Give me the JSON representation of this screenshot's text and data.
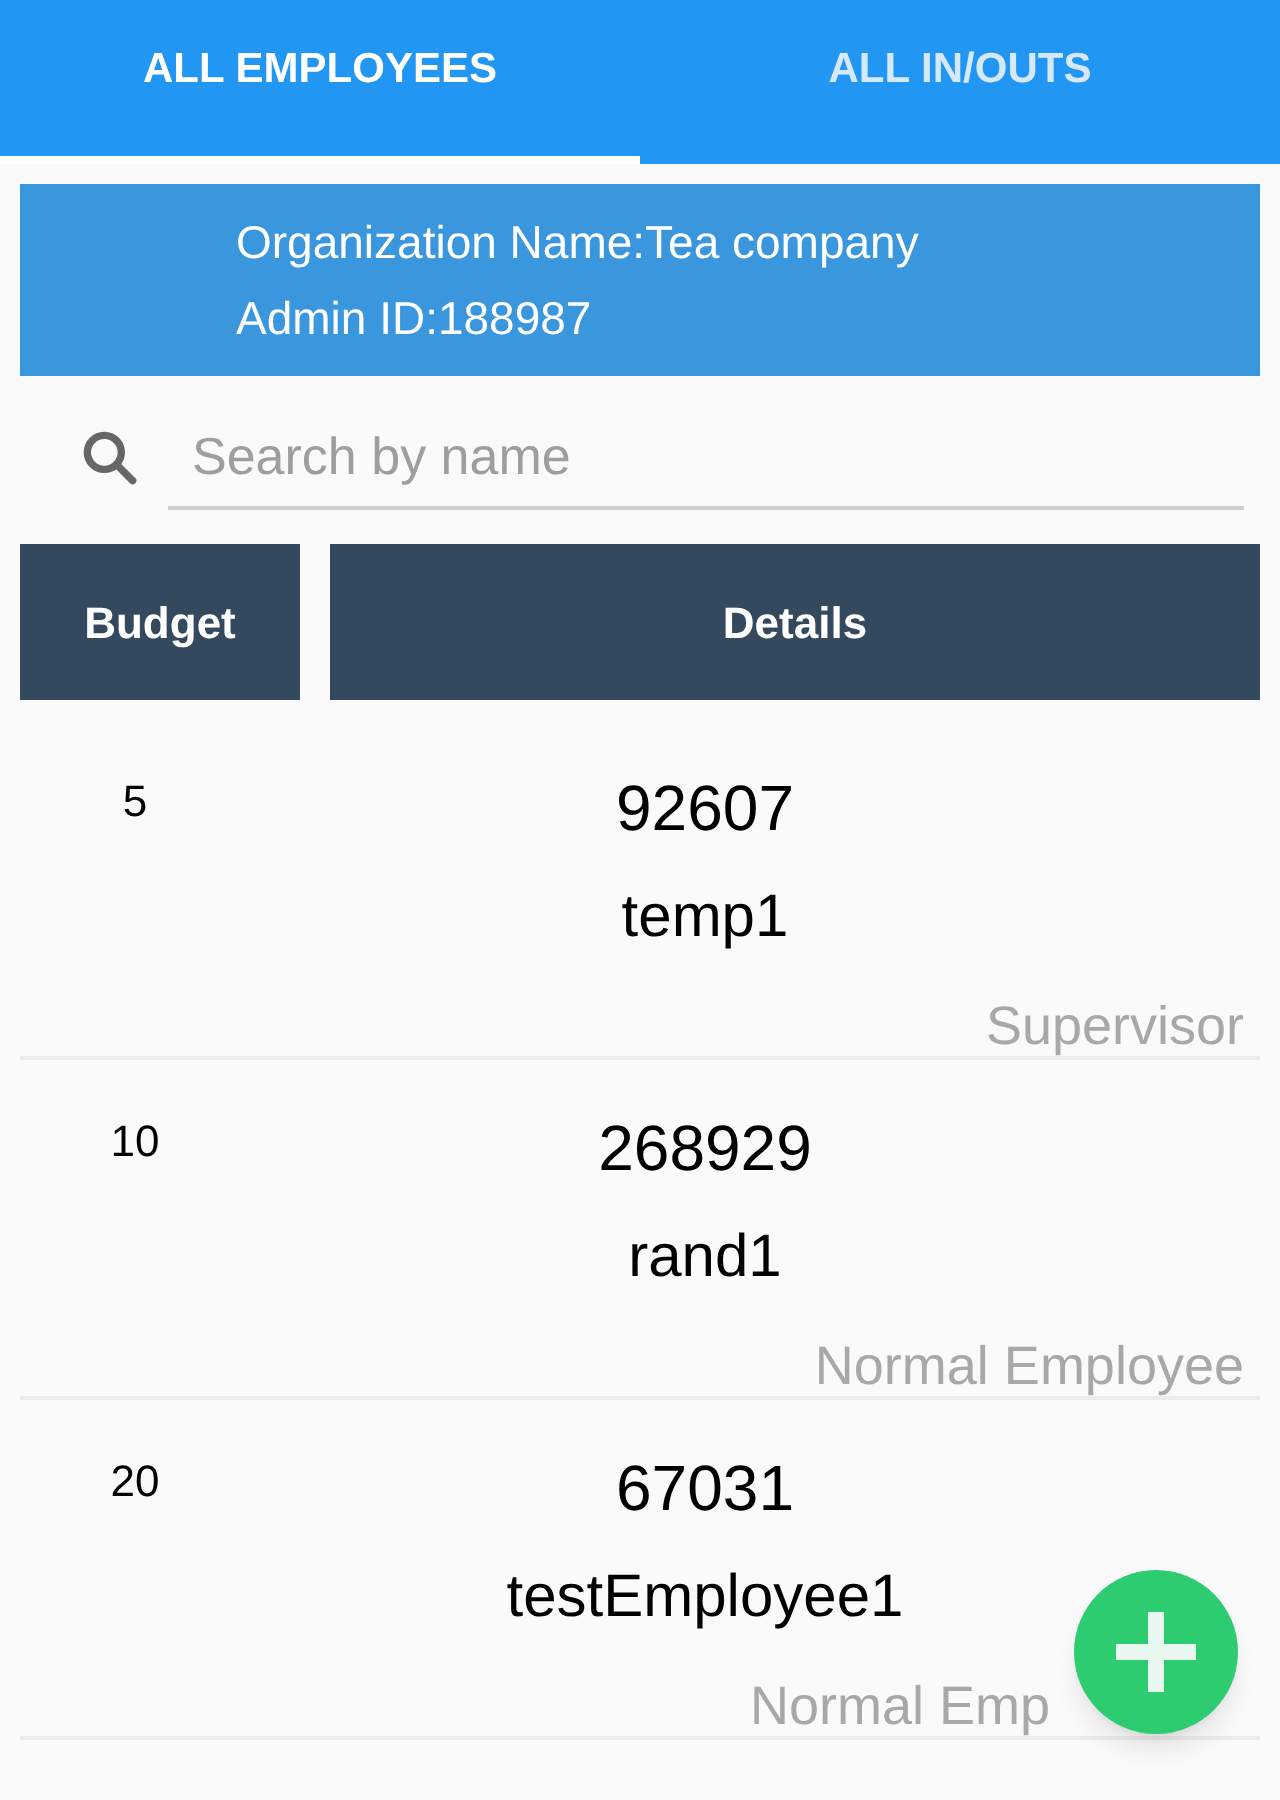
{
  "tabs": [
    {
      "label": "ALL EMPLOYEES",
      "selected": true
    },
    {
      "label": "ALL IN/OUTS",
      "selected": false
    }
  ],
  "organization": {
    "name_line": "Organization Name:Tea company",
    "admin_line": "Admin ID:188987"
  },
  "search": {
    "placeholder": "Search by name"
  },
  "table": {
    "columns": [
      "Budget",
      "Details"
    ],
    "rows": [
      {
        "budget": "5",
        "id": "92607",
        "name": "temp1",
        "role": "Supervisor"
      },
      {
        "budget": "10",
        "id": "268929",
        "name": "rand1",
        "role": "Normal Employee"
      },
      {
        "budget": "20",
        "id": "67031",
        "name": "testEmployee1",
        "role": "Normal Emp"
      }
    ]
  },
  "fab": {
    "kind": "add"
  }
}
